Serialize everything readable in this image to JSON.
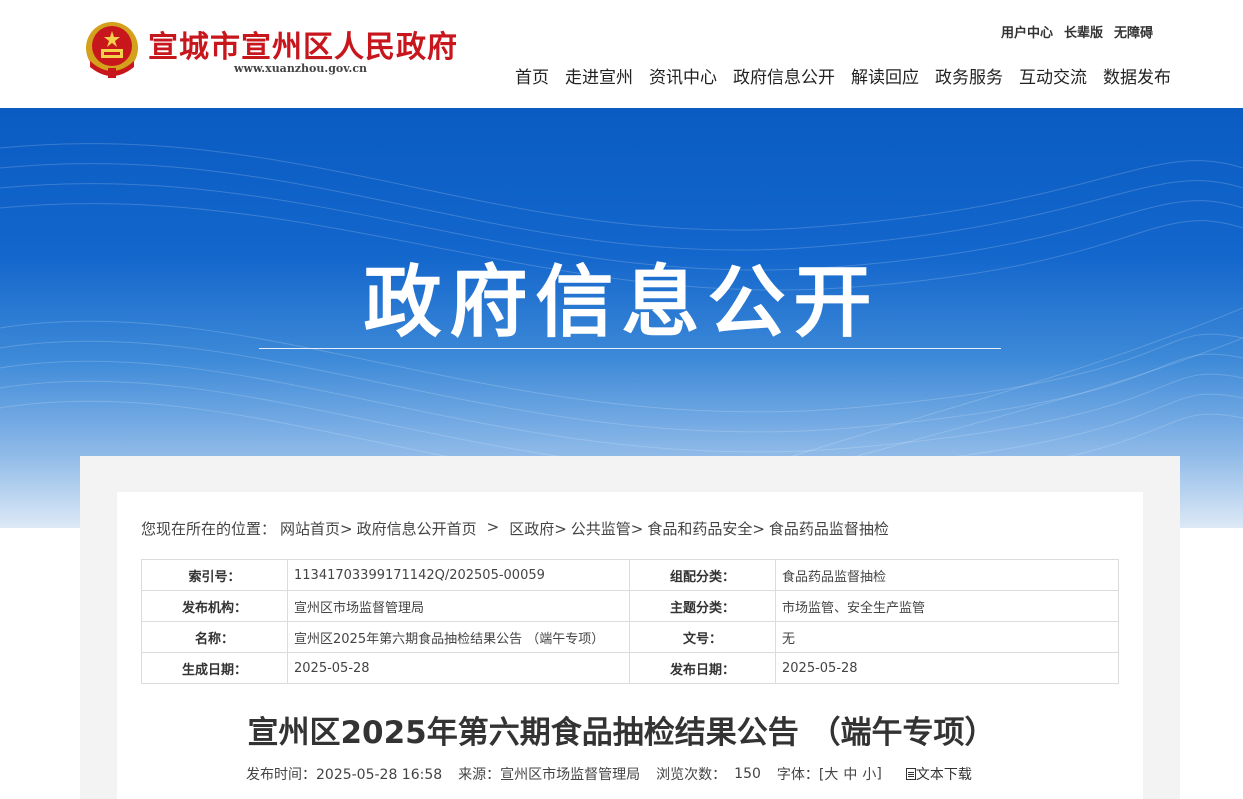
{
  "header": {
    "site_name": "宣城市宣州区人民政府",
    "site_url": "www.xuanzhou.gov.cn",
    "top_links": [
      "用户中心",
      "长辈版",
      "无障碍"
    ],
    "nav": [
      "首页",
      "走进宣州",
      "资讯中心",
      "政府信息公开",
      "解读回应",
      "政务服务",
      "互动交流",
      "数据发布"
    ]
  },
  "banner": {
    "title": "政府信息公开"
  },
  "breadcrumb": {
    "prefix": "您现在所在的位置：",
    "items": [
      "网站首页>",
      "政府信息公开首页",
      ">",
      "区政府>",
      "公共监管>",
      "食品和药品安全>",
      "食品药品监督抽检"
    ]
  },
  "meta": {
    "rows": [
      [
        "索引号：",
        "11341703399171142Q/202505-00059",
        "组配分类：",
        "食品药品监督抽检"
      ],
      [
        "发布机构：",
        "宣州区市场监督管理局",
        "主题分类：",
        "市场监管、安全生产监管"
      ],
      [
        "名称：",
        "宣州区2025年第六期食品抽检结果公告 （端午专项）",
        "文号：",
        "无"
      ],
      [
        "生成日期：",
        "2025-05-28",
        "发布日期：",
        "2025-05-28"
      ]
    ]
  },
  "article": {
    "title": "宣州区2025年第六期食品抽检结果公告 （端午专项）",
    "publish_time": "发布时间：2025-05-28 16:58",
    "source": "来源：宣州区市场监督管理局",
    "views_label": "浏览次数：",
    "views": "150",
    "font_label": "字体：[",
    "font_large": "大",
    "font_medium": "中",
    "font_small": "小",
    "font_close": "]",
    "download": "文本下载"
  },
  "colors": {
    "brand_red": "#c8161d",
    "banner_blue": "#0a5cc2"
  }
}
